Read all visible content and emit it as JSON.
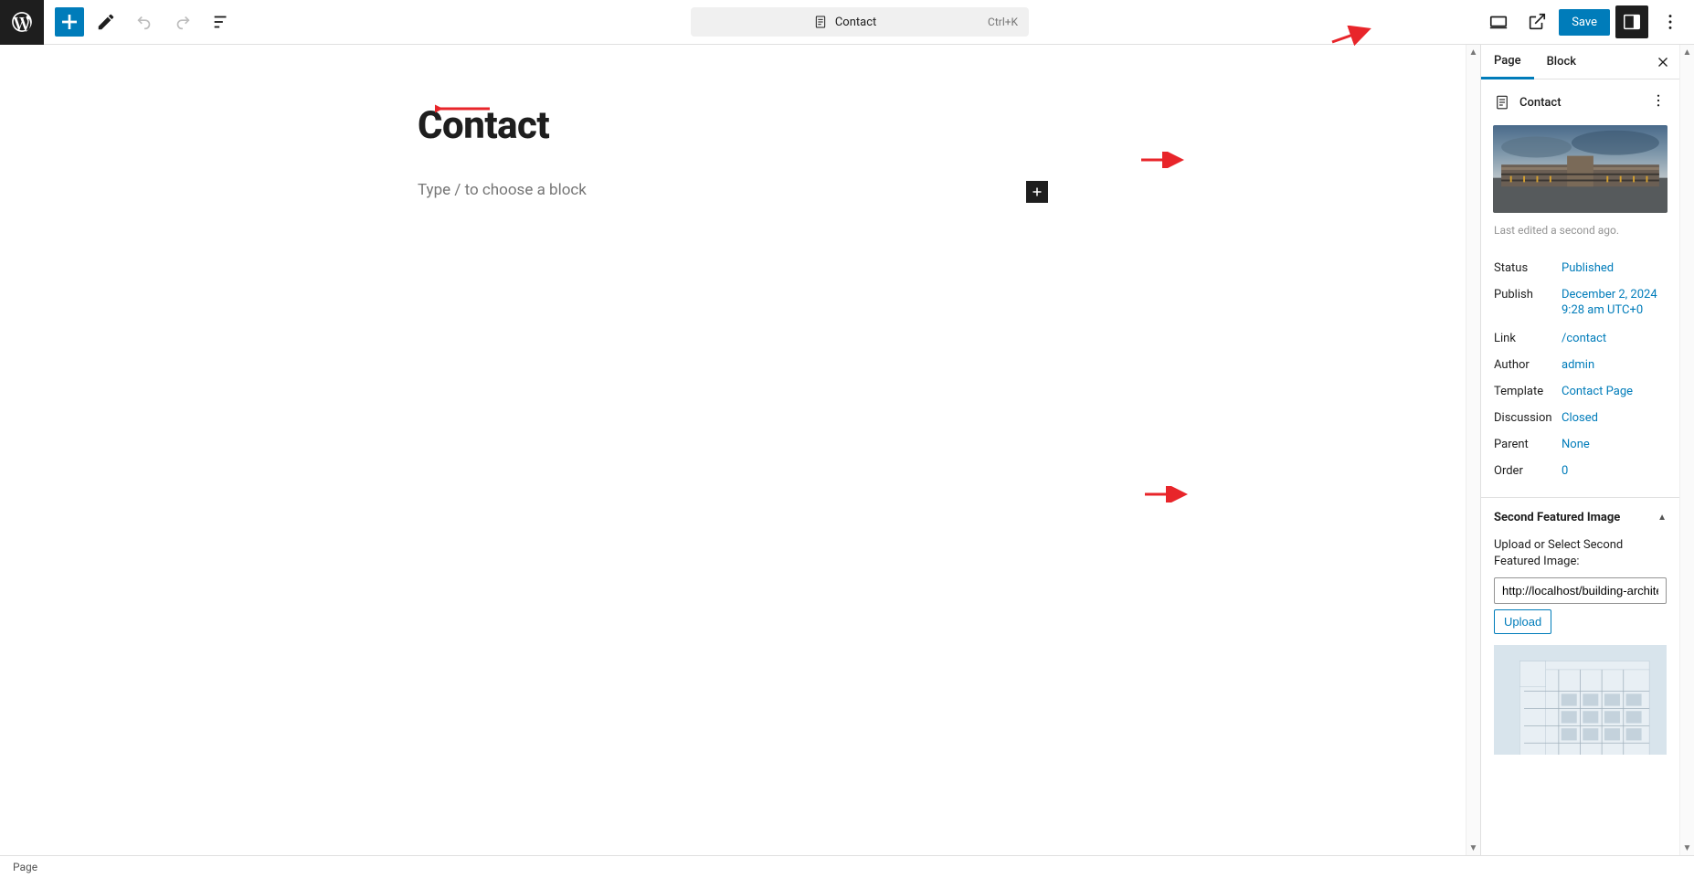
{
  "topbar": {
    "doc_title": "Contact",
    "shortcut": "Ctrl+K",
    "save_label": "Save"
  },
  "editor": {
    "title": "Contact",
    "placeholder": "Type / to choose a block"
  },
  "sidebar": {
    "tabs": {
      "page": "Page",
      "block": "Block"
    },
    "page_title": "Contact",
    "last_edited": "Last edited a second ago.",
    "meta": {
      "status_label": "Status",
      "status_value": "Published",
      "publish_label": "Publish",
      "publish_value_line1": "December 2, 2024",
      "publish_value_line2": "9:28 am UTC+0",
      "link_label": "Link",
      "link_value": "/contact",
      "author_label": "Author",
      "author_value": "admin",
      "template_label": "Template",
      "template_value": "Contact Page",
      "discussion_label": "Discussion",
      "discussion_value": "Closed",
      "parent_label": "Parent",
      "parent_value": "None",
      "order_label": "Order",
      "order_value": "0"
    },
    "second_featured": {
      "title": "Second Featured Image",
      "desc": "Upload or Select Second Featured Image:",
      "url_value": "http://localhost/building-archite",
      "upload_label": "Upload"
    }
  },
  "footer": {
    "breadcrumb": "Page"
  }
}
